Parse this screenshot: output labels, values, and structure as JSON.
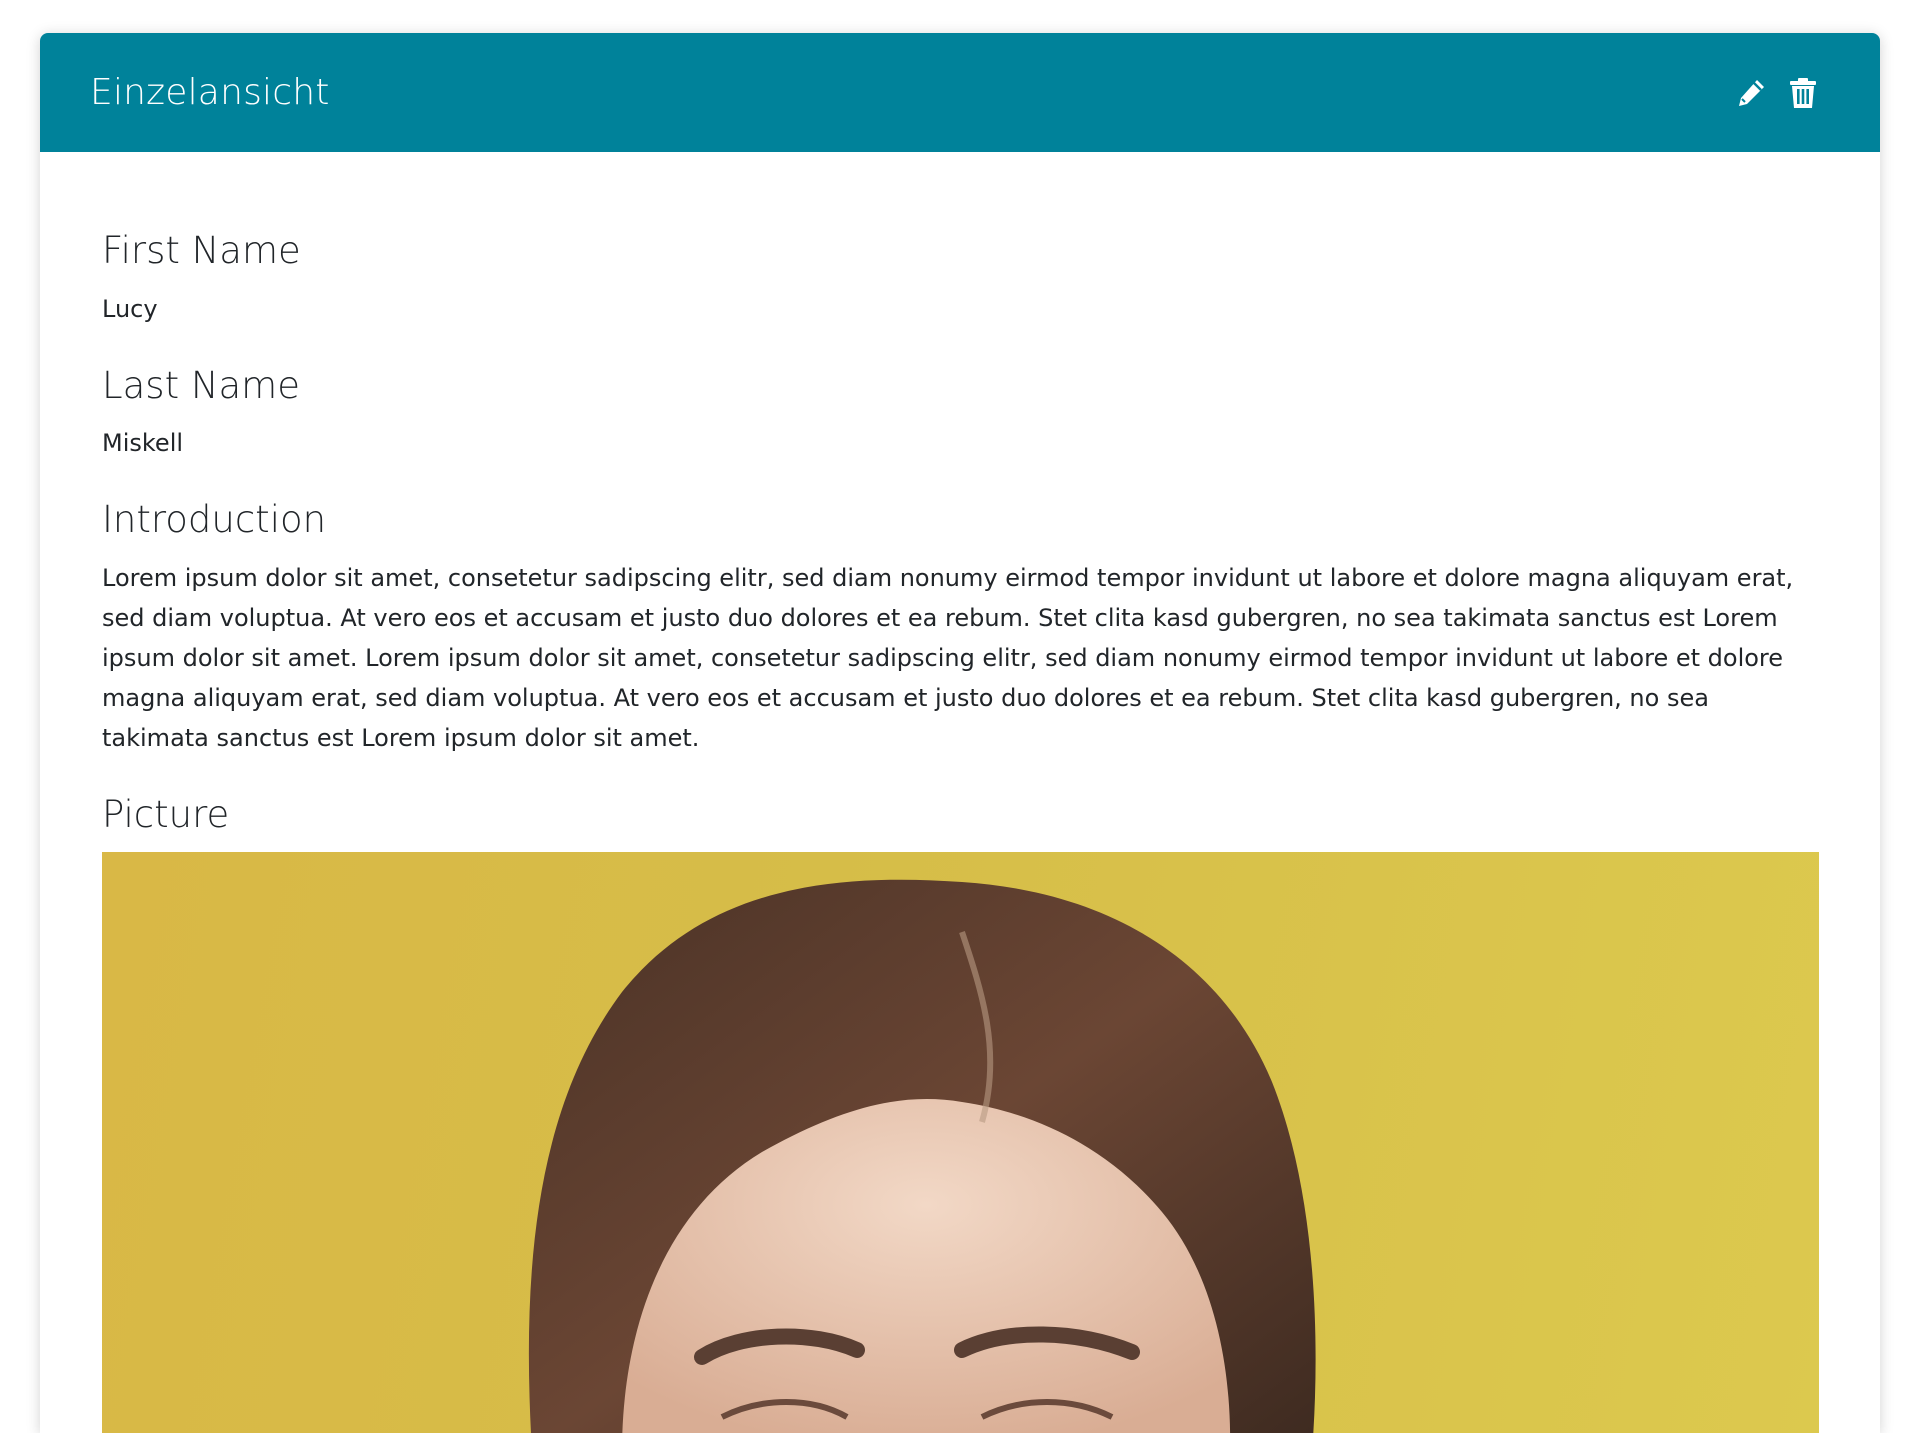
{
  "header": {
    "title": "Einzelansicht",
    "edit_icon": "pencil-icon",
    "delete_icon": "trash-icon",
    "color": "#00829a"
  },
  "fields": {
    "first_name": {
      "label": "First Name",
      "value": "Lucy"
    },
    "last_name": {
      "label": "Last Name",
      "value": "Miskell"
    },
    "introduction": {
      "label": "Introduction",
      "value": "Lorem ipsum dolor sit amet, consetetur sadipscing elitr, sed diam nonumy eirmod tempor invidunt ut labore et dolore magna aliquyam erat, sed diam voluptua. At vero eos et accusam et justo duo dolores et ea rebum. Stet clita kasd gubergren, no sea takimata sanctus est Lorem ipsum dolor sit amet. Lorem ipsum dolor sit amet, consetetur sadipscing elitr, sed diam nonumy eirmod tempor invidunt ut labore et dolore magna aliquyam erat, sed diam voluptua. At vero eos et accusam et justo duo dolores et ea rebum. Stet clita kasd gubergren, no sea takimata sanctus est Lorem ipsum dolor sit amet."
    },
    "picture": {
      "label": "Picture",
      "background": "#d6bd48"
    }
  }
}
